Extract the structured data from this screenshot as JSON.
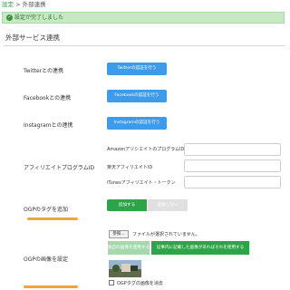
{
  "breadcrumb": {
    "home": "設定",
    "separator": ">",
    "current": "外部連携"
  },
  "alert": {
    "text": "設定が完了しました"
  },
  "page": {
    "title": "外部サービス連携"
  },
  "twitter": {
    "label": "Twitterとの連携",
    "button": "Twitterの認証を行う"
  },
  "facebook": {
    "label": "Facebookとの連携",
    "button": "Facebookの認証を行う"
  },
  "instagram": {
    "label": "Instagramとの連携",
    "button": "Instagramの認証を行う"
  },
  "affiliate": {
    "label": "アフィリエイトプログラムID",
    "amazon_label": "AmazonアソシエイトのプログラムID",
    "rakuten_label": "楽天アフィリエイトID",
    "itunes_label": "iTunesアフィリエイト・トークン",
    "amazon_value": "",
    "rakuten_value": "",
    "itunes_value": ""
  },
  "ogp_tag": {
    "label": "OGPのタグを追加",
    "on": "追加する",
    "off": "追加しない"
  },
  "ogp_image": {
    "label": "OGPの画像を設定",
    "file_button": "参照...",
    "file_status": "ファイルが選択されていません。",
    "option_upload": "独自の画像を使用する",
    "option_article": "記事内に記載した画像があればそれを使用する",
    "remove_label": "OGPタグの画像を消去"
  },
  "colors": {
    "accent_green": "#2ea44a",
    "button_blue": "#3d9be9",
    "alert_bg": "#c6e9c4",
    "annotation_orange": "#f0a43c"
  }
}
